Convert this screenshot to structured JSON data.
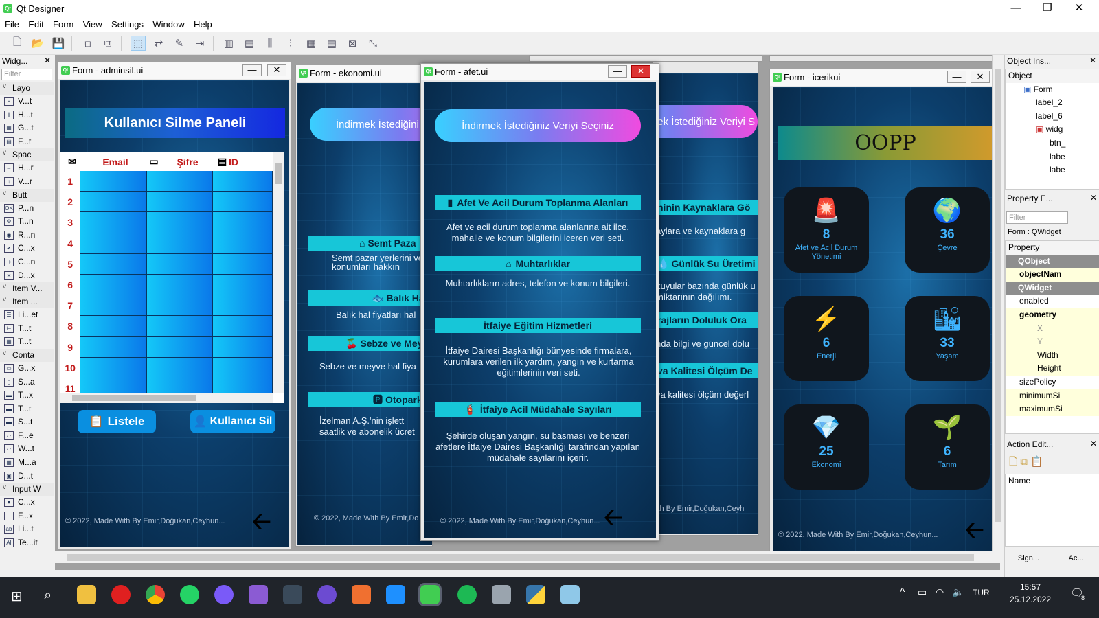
{
  "app": {
    "title": "Qt Designer",
    "min": "—",
    "max": "❐",
    "close": "✕"
  },
  "menu": [
    "File",
    "Edit",
    "Form",
    "View",
    "Settings",
    "Window",
    "Help"
  ],
  "widget_box": {
    "title": "Widg...",
    "filter_placeholder": "Filter",
    "categories": [
      "Layo",
      "Spac",
      "Butt",
      "Item V...",
      "Item ...",
      "Conta",
      "Input W"
    ],
    "layouts": [
      "V...t",
      "H...t",
      "G...t",
      "F...t"
    ],
    "spacers": [
      "H...r",
      "V...r"
    ],
    "buttons": [
      "P...n",
      "T...n",
      "R...n",
      "C...x",
      "C...n",
      "D...x"
    ],
    "item_widgets": [
      "Li...et",
      "T...t",
      "T...t"
    ],
    "containers": [
      "G...x",
      "S...a",
      "T...x",
      "T...t",
      "S...t",
      "F...e",
      "W...t",
      "M...a",
      "D...t"
    ],
    "inputs": [
      "C...x",
      "F...x",
      "Li...t",
      "Te...it"
    ]
  },
  "forms": {
    "adminsil": {
      "title": "Form - adminsil.ui",
      "header": "Kullanıcı Silme Paneli",
      "columns": [
        "Email",
        "Şifre",
        "ID"
      ],
      "rows": [
        "1",
        "2",
        "3",
        "4",
        "5",
        "6",
        "7",
        "8",
        "9",
        "10",
        "11"
      ],
      "btn_list": "Listele",
      "btn_delete": "Kullanıcı Sil",
      "footer": "© 2022, Made With By Emir,Doğukan,Ceyhun..."
    },
    "ekonomi": {
      "title": "Form - ekonomi.ui",
      "pill": "İndirmek İstediğini",
      "items": [
        {
          "h": "Semt Paza",
          "d": "Semt pazar yerlerini ve konumları hakkın"
        },
        {
          "h": "Balık Hal",
          "d": "Balık hal fiyatları hal"
        },
        {
          "h": "Sebze ve Meyv",
          "d": "Sebze ve meyve hal fiya"
        },
        {
          "h": "Otopark",
          "d": "İzelman A.Ş.'nin işlett saatlik ve abonelik ücret"
        }
      ],
      "footer": "© 2022, Made With By Emir,Do"
    },
    "afet": {
      "title": "Form - afet.ui",
      "pill": "İndirmek İstediğiniz Veriyi Seçiniz",
      "items": [
        {
          "h": "Afet Ve Acil Durum Toplanma Alanları",
          "d": "Afet ve acil durum toplanma alanlarına ait ilce, mahalle ve konum bilgilerini iceren veri seti."
        },
        {
          "h": "Muhtarlıklar",
          "d": "Muhtarlıkların adres, telefon ve konum bilgileri."
        },
        {
          "h": "İtfaiye Eğitim Hizmetleri",
          "d": "İtfaiye Dairesi Başkanlığı bünyesinde firmalara, kurumlara verilen ilk yardım, yangın ve kurtarma eğitimlerinin veri seti."
        },
        {
          "h": "İtfaiye Acil Müdahale Sayıları",
          "d": "Şehirde oluşan yangın, su basması ve benzeri afetlere İtfaiye Dairesi Başkanlığı tarafından yapılan müdahale sayılarını içerir."
        }
      ],
      "footer": "© 2022, Made With By Emir,Doğukan,Ceyhun..."
    },
    "cevre": {
      "pill": "ek İstediğiniz Veriyi S",
      "items": [
        {
          "h": "ninin Kaynaklara Gö",
          "d": "aylara ve kaynaklara g"
        },
        {
          "h": "Günlük Su Üretimi",
          "d": "kuyular bazında günlük u miktarının dağılımı."
        },
        {
          "h": "rajların Doluluk Ora",
          "d": "nda bilgi ve güncel dolu"
        },
        {
          "h": "va Kalitesi Ölçüm De",
          "d": "va kalitesi ölçüm değerl"
        }
      ],
      "footer": "ith By Emir,Doğukan,Ceyh"
    },
    "icerik": {
      "title": "Form - icerikui",
      "header": "OOPP",
      "tiles": [
        {
          "n": "8",
          "l": "Afet ve Acil Durum Yönetimi",
          "icon": "siren-icon"
        },
        {
          "n": "36",
          "l": "Çevre",
          "icon": "globe-icon"
        },
        {
          "n": "6",
          "l": "Enerji",
          "icon": "wind-turbine-icon"
        },
        {
          "n": "33",
          "l": "Yaşam",
          "icon": "city-icon"
        },
        {
          "n": "25",
          "l": "Ekonomi",
          "icon": "diamond-icon"
        },
        {
          "n": "6",
          "l": "Tarım",
          "icon": "plant-icon"
        }
      ],
      "footer": "© 2022, Made With By Emir,Doğukan,Ceyhun..."
    }
  },
  "object_inspector": {
    "title": "Object Ins...",
    "header": "Object",
    "tree": [
      "Form",
      "label_2",
      "label_6",
      "widg",
      "btn_",
      "labe",
      "labe"
    ]
  },
  "property_editor": {
    "title": "Property E...",
    "filter_placeholder": "Filter",
    "context": "Form : QWidget",
    "header": "Property",
    "rows": [
      "QObject",
      "objectNam",
      "QWidget",
      "enabled",
      "geometry",
      "X",
      "Y",
      "Width",
      "Height",
      "sizePolicy",
      "minimumSi",
      "maximumSi"
    ]
  },
  "action_editor": {
    "title": "Action Edit...",
    "header": "Name",
    "tabs": [
      "Sign...",
      "Ac..."
    ]
  },
  "taskbar": {
    "lang": "TUR",
    "time": "15:57",
    "date": "25.12.2022",
    "notif": "8"
  },
  "colors": {
    "accent": "#17c6d8",
    "tile_bg": "#10161d",
    "tile_fg": "#3fb4ff",
    "table_cell": "#0aa8f0"
  }
}
